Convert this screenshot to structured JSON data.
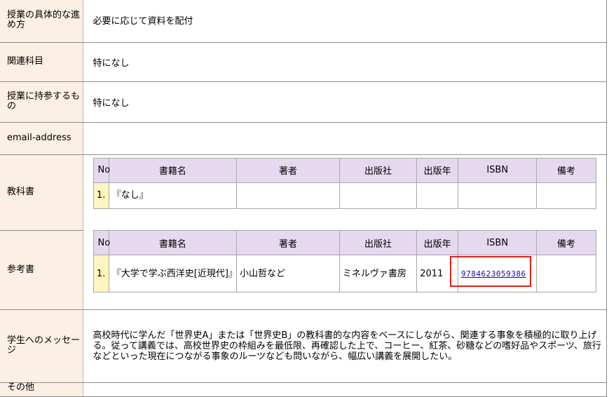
{
  "rows": {
    "method": {
      "label": "授業の具体的な進め方",
      "value": "必要に応じて資料を配付"
    },
    "related": {
      "label": "関連科目",
      "value": "特になし"
    },
    "bring": {
      "label": "授業に持参するもの",
      "value": "特になし"
    },
    "email": {
      "label": "email-address",
      "value": ""
    },
    "textbook": {
      "label": "教科書"
    },
    "reference": {
      "label": "参考書"
    },
    "message": {
      "label": "学生へのメッセージ",
      "value": "高校時代に学んだ「世界史A」または「世界史B」の教科書的な内容をベースにしながら、関連する事象を積極的に取り上げる。従って講義では、高校世界史の枠組みを最低限、再確認した上で、コーヒー、紅茶、砂糖などの嗜好品やスポーツ、旅行などといった現在につながる事象のルーツなども問いながら、幅広い講義を展開したい。"
    },
    "other": {
      "label": "その他"
    }
  },
  "book_headers": {
    "no": "No",
    "title": "書籍名",
    "author": "著者",
    "publisher": "出版社",
    "year": "出版年",
    "isbn": "ISBN",
    "note": "備考"
  },
  "textbook_rows": [
    {
      "no": "1.",
      "title": "『なし』",
      "author": "",
      "publisher": "",
      "year": "",
      "isbn": "",
      "note": ""
    }
  ],
  "reference_rows": [
    {
      "no": "1.",
      "title": "『大学で学ぶ西洋史[近現代]』",
      "author": "小山哲など",
      "publisher": "ミネルヴァ書房",
      "year": "2011",
      "isbn": "9784623059386",
      "note": ""
    }
  ],
  "colors": {
    "label_bg": "#fcefe3",
    "header_bg": "#e6d9ef",
    "num_bg": "#fff4c2",
    "highlight": "#e0201a",
    "link": "#1a0dab"
  }
}
